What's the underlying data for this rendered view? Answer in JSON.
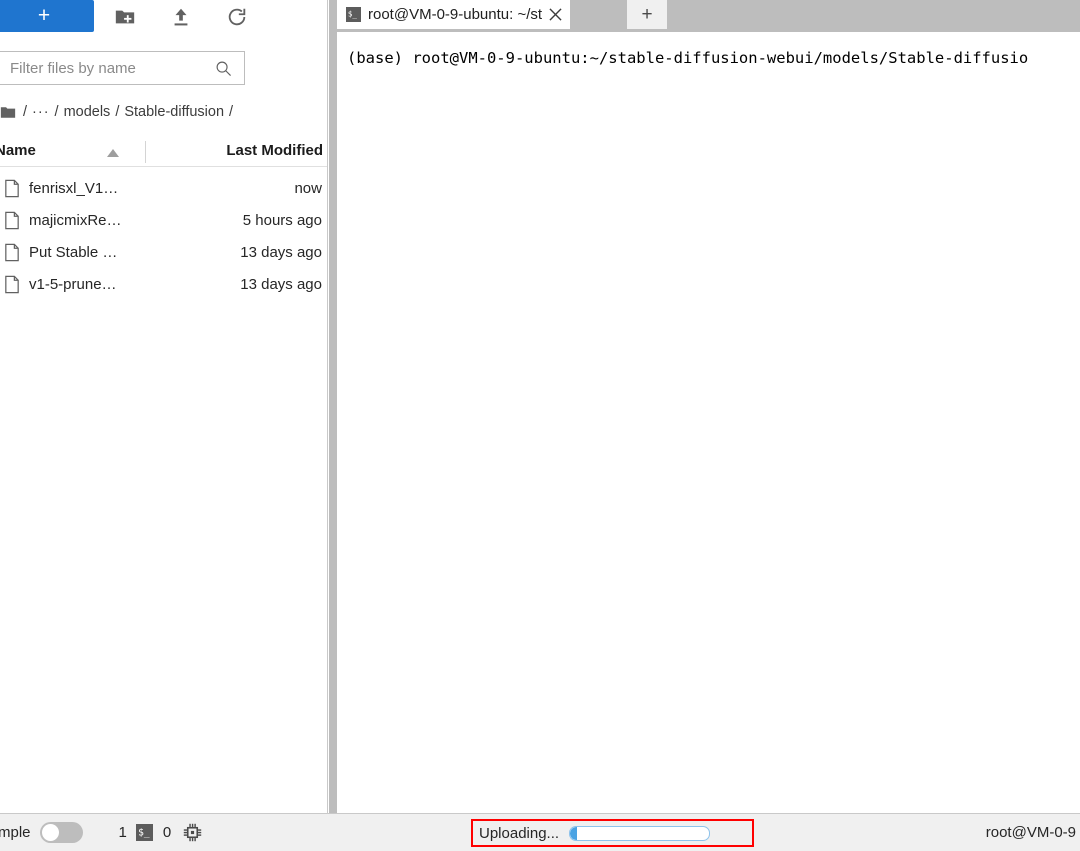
{
  "file_browser": {
    "toolbar": {
      "new_launcher_label": "+",
      "new_folder_icon": "new-folder-icon",
      "upload_icon": "upload-icon",
      "refresh_icon": "refresh-icon"
    },
    "filter": {
      "placeholder": "Filter files by name",
      "value": "",
      "icon": "search-icon"
    },
    "breadcrumb": {
      "home_icon": "folder-icon",
      "separator": "/",
      "ellipsis": "···",
      "items": [
        "models",
        "Stable-diffusion"
      ]
    },
    "columns": {
      "name": "Name",
      "last_modified": "Last Modified",
      "sort_icon": "sort-ascending-icon"
    },
    "files": [
      {
        "icon": "file-icon",
        "name": "fenrisxl_V1…",
        "modified": "now"
      },
      {
        "icon": "file-icon",
        "name": "majicmixRe…",
        "modified": "5 hours ago"
      },
      {
        "icon": "file-icon",
        "name": "Put Stable …",
        "modified": "13 days ago"
      },
      {
        "icon": "file-icon",
        "name": "v1-5-prune…",
        "modified": "13 days ago"
      }
    ]
  },
  "main": {
    "tabs": [
      {
        "icon": "terminal-icon",
        "label": "root@VM-0-9-ubuntu: ~/st",
        "close_icon": "close-icon",
        "active": true
      }
    ],
    "new_tab_label": "+",
    "terminal": {
      "line": "(base) root@VM-0-9-ubuntu:~/stable-diffusion-webui/models/Stable-diffusio"
    }
  },
  "status_bar": {
    "simple_label": "mple",
    "simple_toggle_on": false,
    "kernel_count": "1",
    "terminal_icon": "terminal-icon",
    "notebook_count": "0",
    "cpu_icon": "cpu-chip-icon",
    "upload": {
      "label": "Uploading...",
      "progress_percent": 5,
      "annotation_color": "#ff0000"
    },
    "host": "root@VM-0-9"
  },
  "colors": {
    "accent_blue": "#1f75cf",
    "progress_blue": "#4ba3e3",
    "tabbar_grey": "#bdbdbd",
    "statusbar_grey": "#f0f0f0",
    "annotation_red": "#ff0000"
  }
}
